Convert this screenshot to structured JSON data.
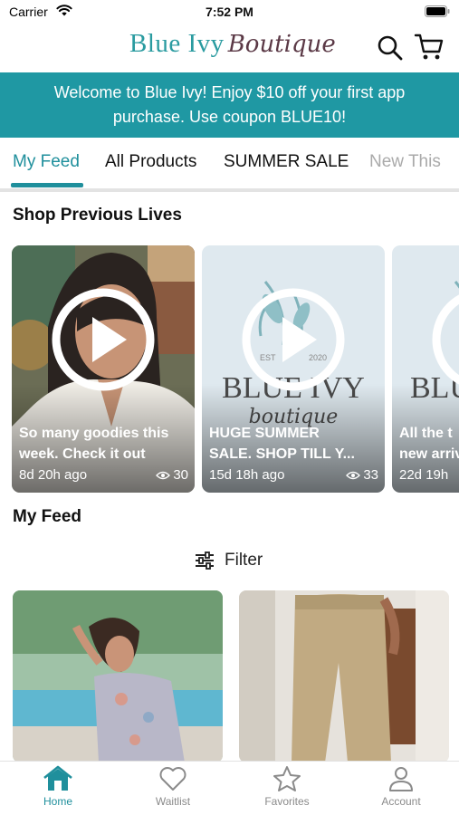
{
  "status_bar": {
    "carrier": "Carrier",
    "time": "7:52 PM"
  },
  "header": {
    "logo_part1": "Blue Ivy",
    "logo_part2": "Boutique"
  },
  "promo": {
    "line1": "Welcome to Blue Ivy! Enjoy $10 off your first app",
    "line2": "purchase. Use coupon BLUE10!"
  },
  "tabs": [
    {
      "label": "My Feed",
      "active": true
    },
    {
      "label": "All Products"
    },
    {
      "label": "SUMMER SALE"
    },
    {
      "label": "New This"
    }
  ],
  "lives_section": {
    "title": "Shop Previous Lives",
    "items": [
      {
        "title_line1": "So many goodies this",
        "title_line2": "week. Check it out",
        "time": "8d 20h ago",
        "views": "30"
      },
      {
        "title_line1": "HUGE SUMMER",
        "title_line2": "SALE. SHOP TILL Y...",
        "time": "15d 18h ago",
        "views": "33",
        "thumb_text": "BLUE IVY",
        "thumb_script": "boutique",
        "thumb_est": "EST",
        "thumb_year": "2020"
      },
      {
        "title_line1": "All the t",
        "title_line2": "new arriv",
        "time": "22d 19h",
        "thumb_text": "BLUE"
      }
    ]
  },
  "feed_section": {
    "title": "My Feed",
    "filter_label": "Filter"
  },
  "bottom_nav": [
    {
      "label": "Home",
      "icon": "home-icon",
      "active": true
    },
    {
      "label": "Waitlist",
      "icon": "heart-icon"
    },
    {
      "label": "Favorites",
      "icon": "star-icon"
    },
    {
      "label": "Account",
      "icon": "person-icon"
    }
  ],
  "colors": {
    "accent": "#1f8f9c",
    "banner": "#1f98a3",
    "logo_teal": "#2a9ba0",
    "logo_plum": "#5b3946"
  }
}
